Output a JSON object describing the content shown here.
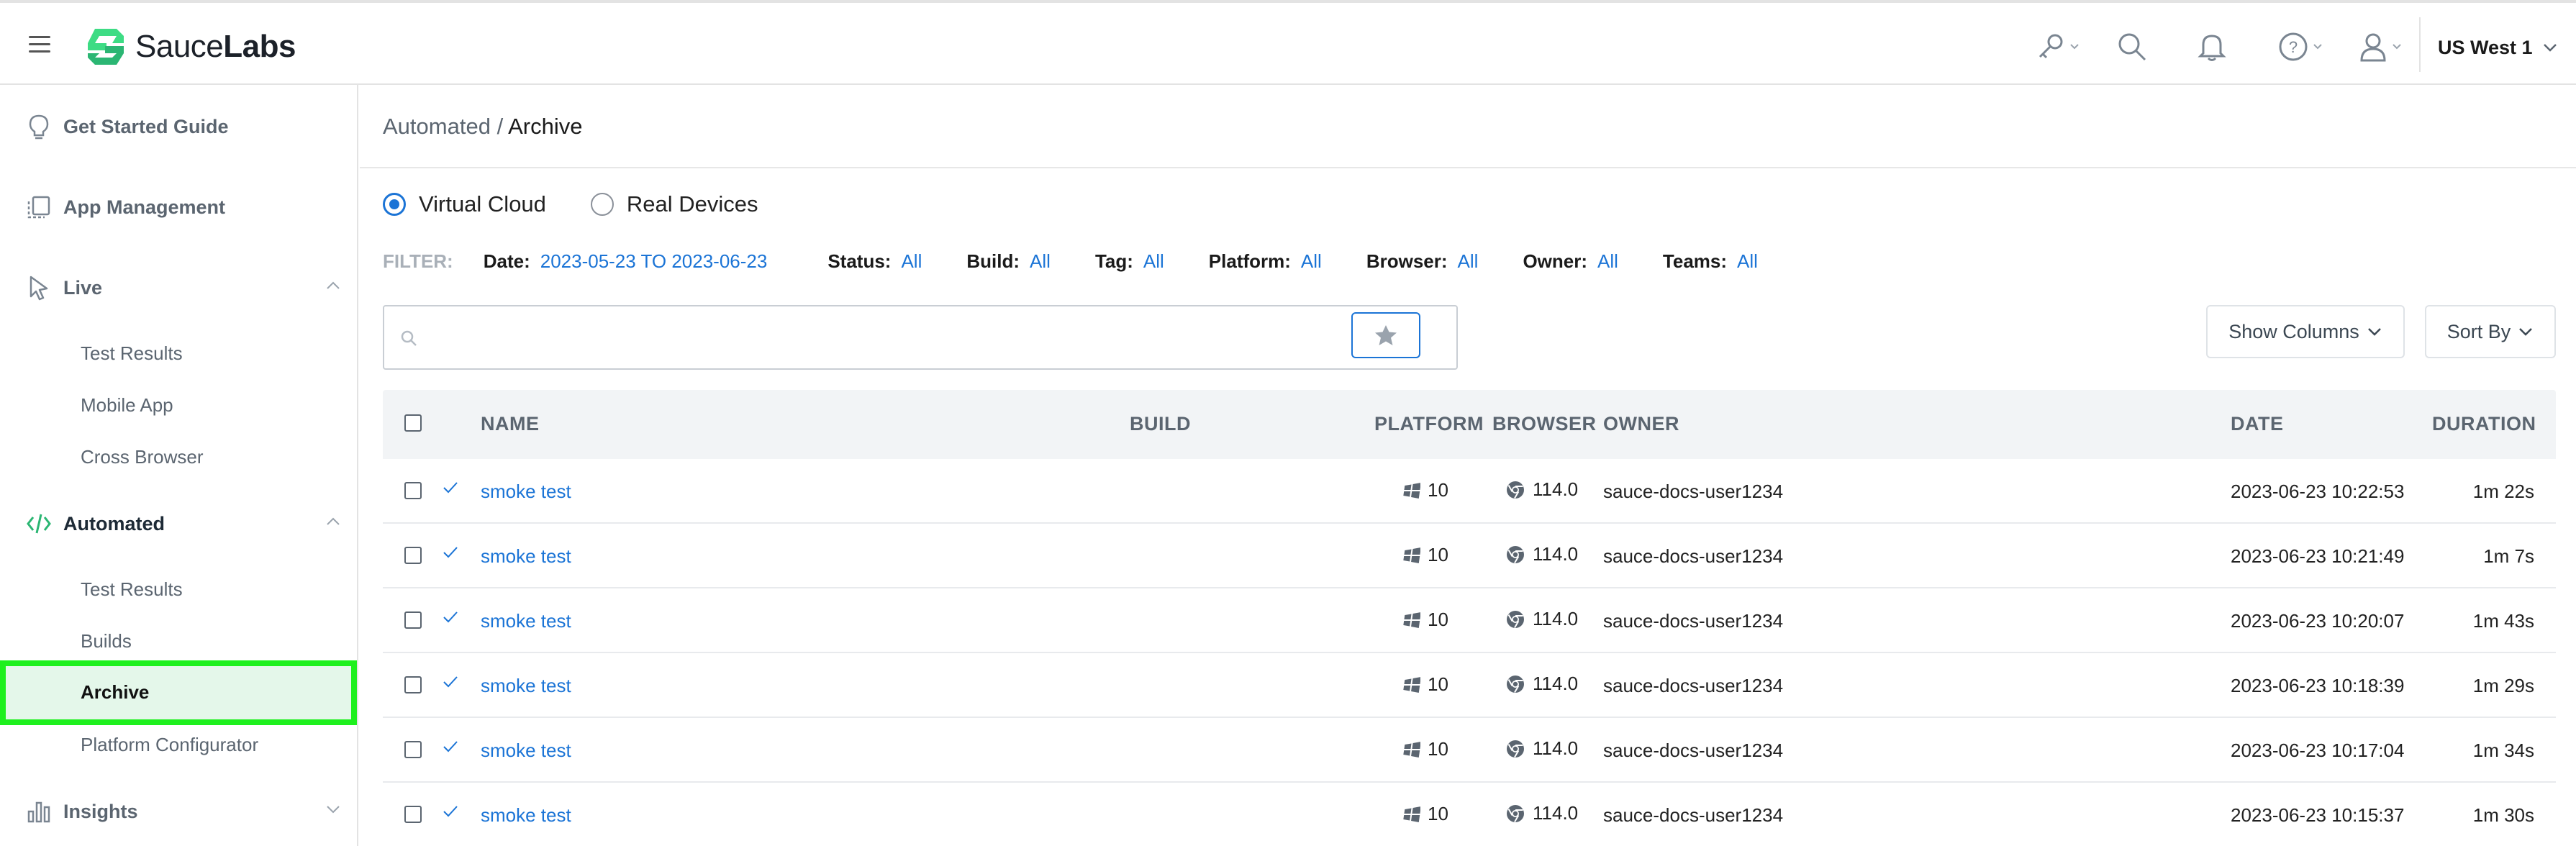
{
  "header": {
    "logo_text_1": "Sauce",
    "logo_text_2": "Labs",
    "region": "US West 1",
    "icons": [
      "key-icon",
      "search-icon",
      "bell-icon",
      "help-icon",
      "user-icon"
    ]
  },
  "sidebar": {
    "get_started": "Get Started Guide",
    "app_management": "App Management",
    "live": {
      "label": "Live",
      "items": [
        "Test Results",
        "Mobile App",
        "Cross Browser"
      ]
    },
    "automated": {
      "label": "Automated",
      "items": [
        "Test Results",
        "Builds",
        "Archive",
        "Platform Configurator"
      ]
    },
    "insights": "Insights"
  },
  "breadcrumb": {
    "parent": "Automated",
    "separator": "/",
    "current": "Archive"
  },
  "device_toggle": {
    "options": [
      "Virtual Cloud",
      "Real Devices"
    ],
    "selected": "Virtual Cloud"
  },
  "filters": {
    "label": "FILTER:",
    "date_key": "Date:",
    "date_value": "2023-05-23 TO 2023-06-23",
    "status_key": "Status:",
    "status_value": "All",
    "build_key": "Build:",
    "build_value": "All",
    "tag_key": "Tag:",
    "tag_value": "All",
    "platform_key": "Platform:",
    "platform_value": "All",
    "browser_key": "Browser:",
    "browser_value": "All",
    "owner_key": "Owner:",
    "owner_value": "All",
    "teams_key": "Teams:",
    "teams_value": "All"
  },
  "search": {
    "placeholder": ""
  },
  "toolbar": {
    "show_columns": "Show Columns",
    "sort_by": "Sort By"
  },
  "table": {
    "columns": {
      "name": "NAME",
      "build": "BUILD",
      "platform": "PLATFORM",
      "browser": "BROWSER",
      "owner": "OWNER",
      "date": "DATE",
      "duration": "DURATION"
    },
    "rows": [
      {
        "name": "smoke test",
        "build": "",
        "platform": "10",
        "browser": "114.0",
        "owner": "sauce-docs-user1234",
        "date": "2023-06-23 10:22:53",
        "duration": "1m 22s"
      },
      {
        "name": "smoke test",
        "build": "",
        "platform": "10",
        "browser": "114.0",
        "owner": "sauce-docs-user1234",
        "date": "2023-06-23 10:21:49",
        "duration": "1m 7s"
      },
      {
        "name": "smoke test",
        "build": "",
        "platform": "10",
        "browser": "114.0",
        "owner": "sauce-docs-user1234",
        "date": "2023-06-23 10:20:07",
        "duration": "1m 43s"
      },
      {
        "name": "smoke test",
        "build": "",
        "platform": "10",
        "browser": "114.0",
        "owner": "sauce-docs-user1234",
        "date": "2023-06-23 10:18:39",
        "duration": "1m 29s"
      },
      {
        "name": "smoke test",
        "build": "",
        "platform": "10",
        "browser": "114.0",
        "owner": "sauce-docs-user1234",
        "date": "2023-06-23 10:17:04",
        "duration": "1m 34s"
      },
      {
        "name": "smoke test",
        "build": "",
        "platform": "10",
        "browser": "114.0",
        "owner": "sauce-docs-user1234",
        "date": "2023-06-23 10:15:37",
        "duration": "1m 30s"
      }
    ]
  },
  "colors": {
    "accent": "#1b74d6",
    "brand_green": "#3ddc84",
    "highlight_border": "#1ef01e",
    "highlight_fill": "#e4f7ea"
  }
}
